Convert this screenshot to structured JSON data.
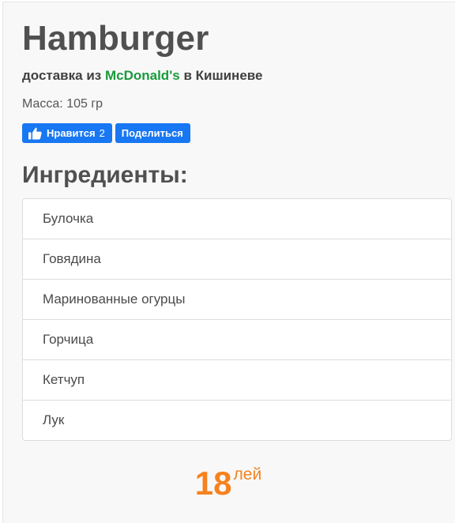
{
  "product": {
    "name": "Hamburger",
    "subtitle_prefix": "доставка из",
    "brand": "McDonald's",
    "subtitle_suffix": "в Кишиневе",
    "weight": "Масса: 105 гр"
  },
  "social": {
    "like_label": "Нравится",
    "like_count": "2",
    "share_label": "Поделиться",
    "button_color": "#1877f2",
    "like_icon": "thumbs-up-icon"
  },
  "ingredients": {
    "title": "Ингредиенты:",
    "items": [
      "Булочка",
      "Говядина",
      "Маринованные огурцы",
      "Горчица",
      "Кетчуп",
      "Лук"
    ]
  },
  "price": {
    "amount": "18",
    "currency": "лей",
    "color": "#f58220"
  },
  "colors": {
    "brand_green": "#1a9a3c"
  }
}
